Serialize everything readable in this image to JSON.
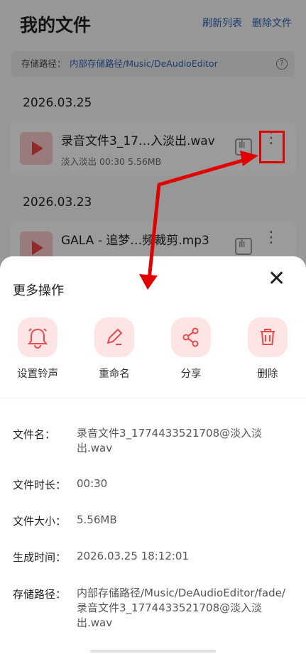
{
  "header": {
    "title": "我的文件",
    "refresh_label": "刷新列表",
    "delete_label": "删除文件"
  },
  "path_bar": {
    "label": "存储路径：",
    "path": "内部存储路径/Music/DeAudioEditor",
    "help_symbol": "?"
  },
  "groups": [
    {
      "date": "2026.03.25",
      "files": [
        {
          "name": "录音文件3_17…入淡出.wav",
          "meta": "淡入淡出   00:30   5.56MB"
        }
      ]
    },
    {
      "date": "2026.03.23",
      "files": [
        {
          "name": "GALA - 追梦…频裁剪.mp3",
          "meta": ""
        }
      ]
    }
  ],
  "sheet": {
    "title": "更多操作",
    "close_symbol": "✕",
    "actions": [
      {
        "label": "设置铃声",
        "icon": "bell-icon"
      },
      {
        "label": "重命名",
        "icon": "edit-icon"
      },
      {
        "label": "分享",
        "icon": "share-icon"
      },
      {
        "label": "删除",
        "icon": "trash-icon"
      }
    ],
    "info": [
      {
        "label": "文件名：",
        "value": "录音文件3_1774433521708@淡入淡出.wav"
      },
      {
        "label": "文件时长：",
        "value": "00:30"
      },
      {
        "label": "文件大小：",
        "value": "5.56MB"
      },
      {
        "label": "生成时间：",
        "value": "2026.03.25 18:12:01"
      },
      {
        "label": "存储路径：",
        "value": "内部存储路径/Music/DeAudioEditor/fade/录音文件3_1774433521708@淡入淡出.wav"
      }
    ]
  },
  "colors": {
    "accent": "#e94b4b",
    "link": "#2d5fae",
    "annotation": "#e10000"
  }
}
